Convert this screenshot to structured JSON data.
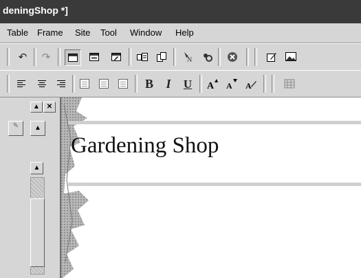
{
  "window": {
    "title": "deningShop *]"
  },
  "menu": {
    "items": [
      "Table",
      "Frame",
      "Site",
      "Tool",
      "Window",
      "Help"
    ]
  },
  "toolbar1": {
    "icons": [
      "undo-icon",
      "redo-icon",
      "normal-view-icon",
      "html-view-icon",
      "preview-icon",
      "page-properties-icon",
      "copy-page-icon",
      "link-icon",
      "image-map-icon",
      "stop-icon",
      "edit-icon",
      "picture-icon"
    ]
  },
  "toolbar2": {
    "icons": [
      "align-left-icon",
      "align-center-icon",
      "align-right-icon",
      "bullet-list-icon",
      "numbered-list-icon",
      "indent-icon",
      "bold-icon",
      "italic-icon",
      "underline-icon",
      "font-larger-icon",
      "font-smaller-icon",
      "font-color-icon",
      "table-grid-icon"
    ],
    "bold": "B",
    "italic": "I",
    "underline": "U"
  },
  "document": {
    "heading": "Gardening Shop"
  }
}
